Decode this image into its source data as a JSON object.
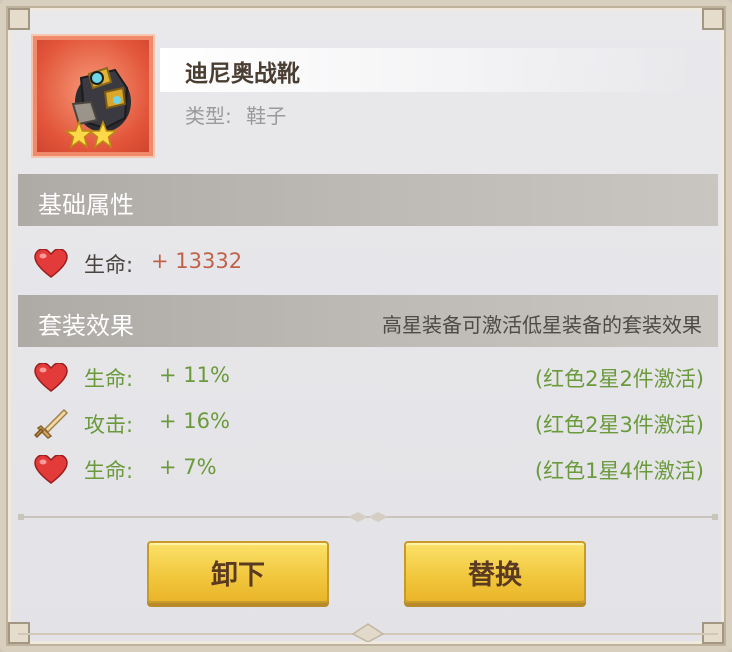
{
  "item": {
    "name": "迪尼奥战靴",
    "type_label": "类型:",
    "type_value": "鞋子",
    "stars": 2
  },
  "basic_section": {
    "title": "基础属性",
    "stats": [
      {
        "icon": "heart-icon",
        "label": "生命:",
        "value": "+ 13332"
      }
    ]
  },
  "set_section": {
    "title": "套装效果",
    "note": "高星装备可激活低星装备的套装效果",
    "effects": [
      {
        "icon": "heart-icon",
        "label": "生命:",
        "value": "+ 11%",
        "condition": "(红色2星2件激活)"
      },
      {
        "icon": "sword-icon",
        "label": "攻击:",
        "value": "+ 16%",
        "condition": "(红色2星3件激活)"
      },
      {
        "icon": "heart-icon",
        "label": "生命:",
        "value": "+ 7%",
        "condition": "(红色1星4件激活)"
      }
    ]
  },
  "buttons": {
    "unequip": "卸下",
    "replace": "替换"
  },
  "colors": {
    "basic_value": "#c0614a",
    "set_text": "#6b9a3c",
    "label_text": "#4a4440",
    "button": "#f1c63c"
  }
}
